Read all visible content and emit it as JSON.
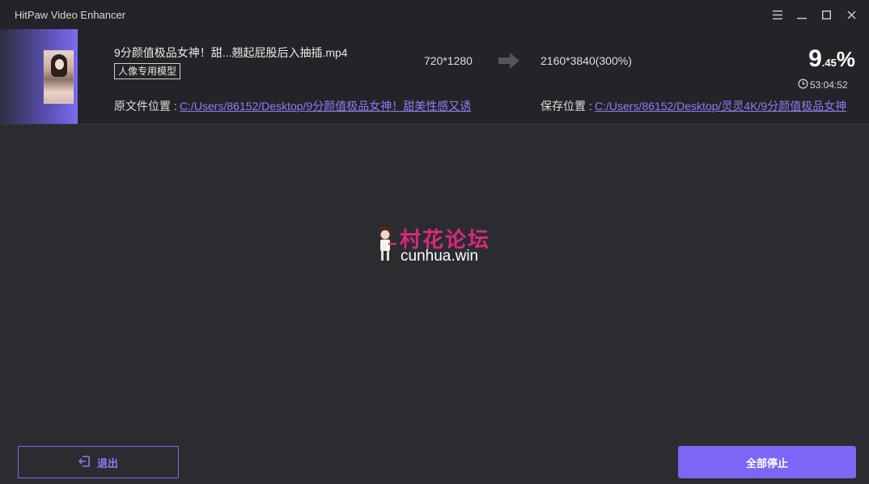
{
  "window": {
    "title": "HitPaw Video Enhancer"
  },
  "task": {
    "file_name": "9分颜值极品女神！甜...翘起屁股后入抽插.mp4",
    "model_tag": "人像专用模型",
    "source_resolution": "720*1280",
    "target_resolution": "2160*3840(300%)",
    "progress_int": "9",
    "progress_dec": ".45",
    "progress_symbol": "%",
    "progress_percent": 9.45,
    "remaining_time": "53:04:52",
    "source_label": "原文件位置 : ",
    "source_path": "C:/Users/86152/Desktop/9分颜值极品女神！甜美性感又诱",
    "save_label": "保存位置 : ",
    "save_path": "C:/Users/86152/Desktop/灵灵4K/9分颜值极品女神"
  },
  "watermark": {
    "cn": "村花论坛",
    "en": "cunhua.win"
  },
  "footer": {
    "exit_label": "退出",
    "stop_all_label": "全部停止"
  },
  "colors": {
    "accent": "#7b66f6",
    "link": "#8d7df5",
    "background": "#2b2c30",
    "panel": "#232427"
  }
}
